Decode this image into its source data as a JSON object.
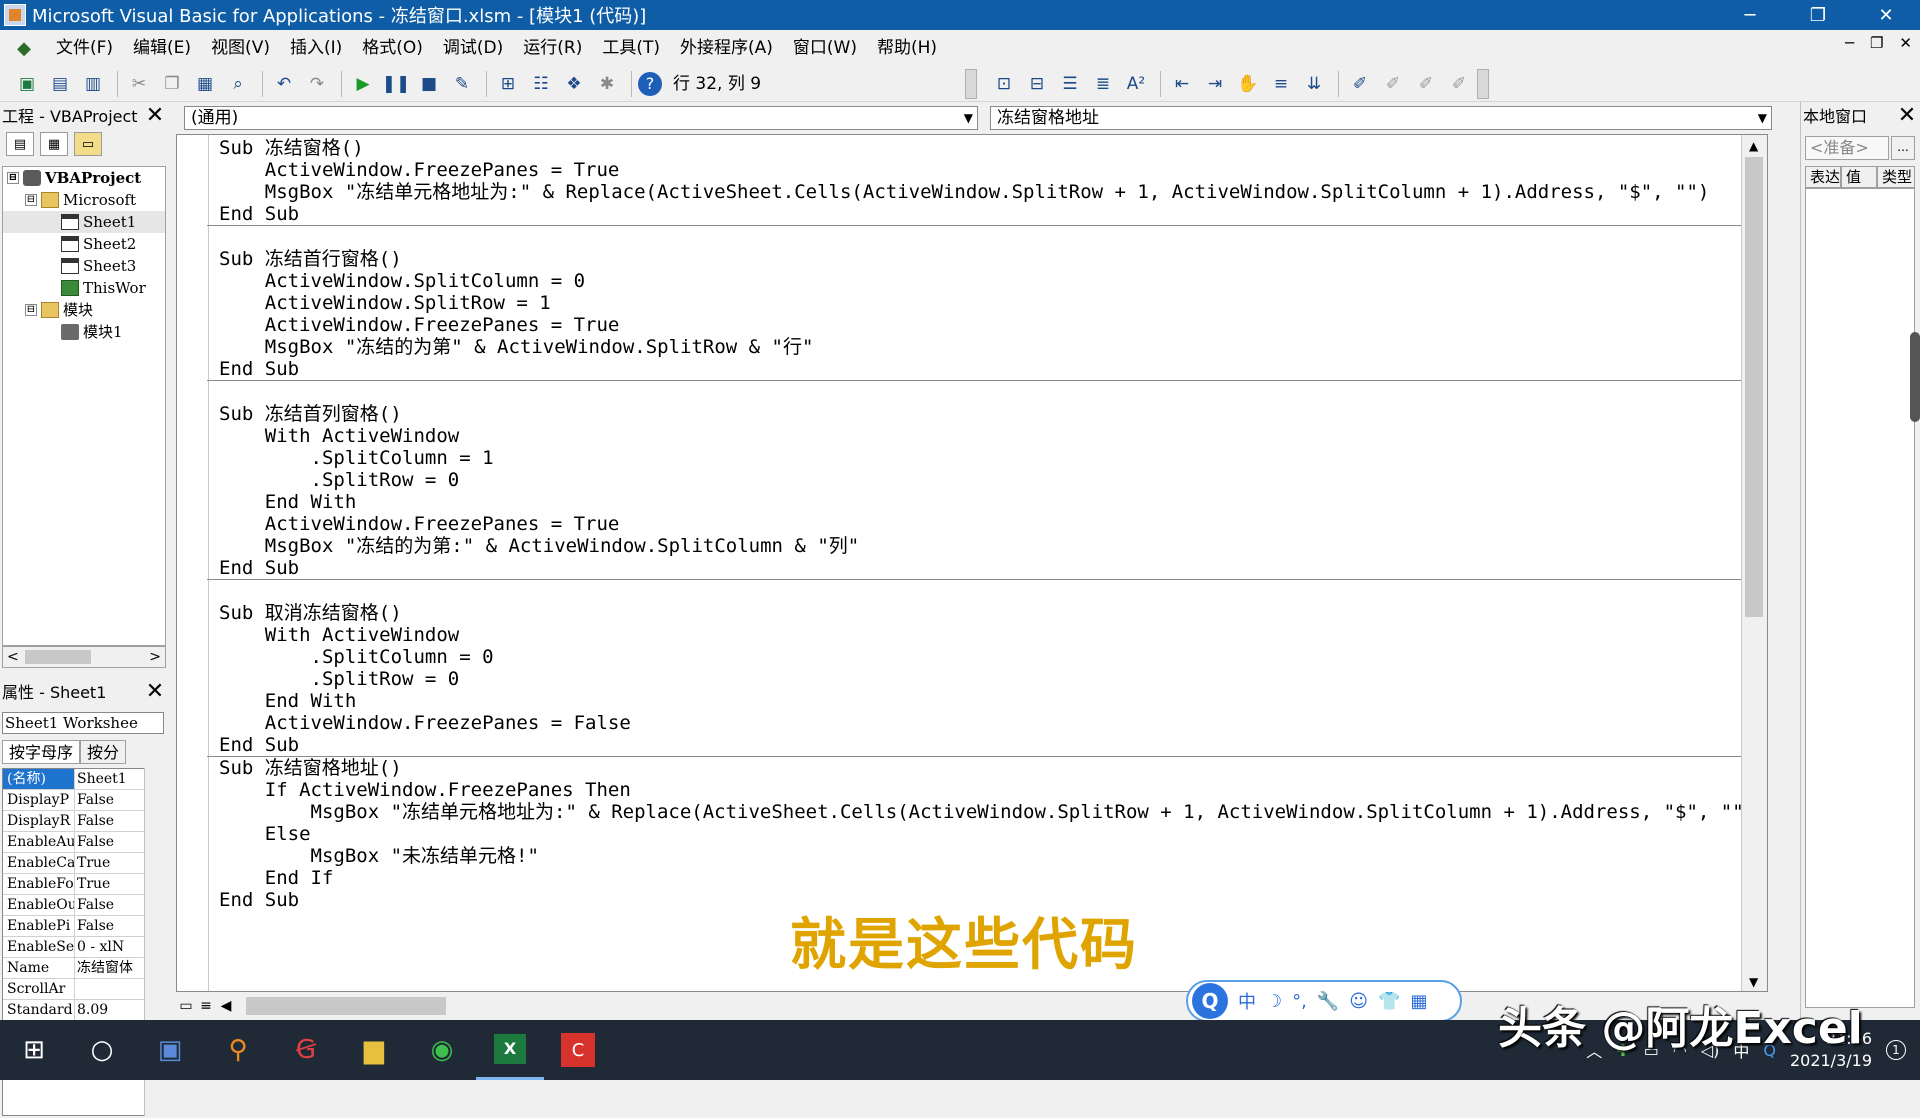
{
  "window": {
    "title": "Microsoft Visual Basic for Applications - 冻结窗口.xlsm - [模块1 (代码)]",
    "min": "─",
    "restore": "❐",
    "close": "✕"
  },
  "menu": [
    "文件(F)",
    "编辑(E)",
    "视图(V)",
    "插入(I)",
    "格式(O)",
    "调试(D)",
    "运行(R)",
    "工具(T)",
    "外接程序(A)",
    "窗口(W)",
    "帮助(H)"
  ],
  "mdi_buttons": {
    "min": "─",
    "restore": "❐",
    "close": "✕"
  },
  "toolbar": {
    "status": "行 32, 列 9",
    "icons": [
      "excel-icon",
      "insert-userform-icon",
      "save-icon",
      "cut-icon",
      "copy-icon",
      "paste-icon",
      "find-icon",
      "undo-icon",
      "redo-icon",
      "run-icon",
      "break-icon",
      "reset-icon",
      "design-mode-icon",
      "project-explorer-icon",
      "properties-icon",
      "object-browser-icon",
      "toolbox-icon",
      "help-icon"
    ]
  },
  "project_panel": {
    "title": "工程 - VBAProject",
    "close": "✕",
    "tree": [
      {
        "label": "VBAProject",
        "level": 0,
        "icon": "project",
        "toggle": "⊟"
      },
      {
        "label": "Microsoft",
        "level": 1,
        "icon": "folder",
        "toggle": "⊟"
      },
      {
        "label": "Sheet1",
        "level": 2,
        "icon": "sheet",
        "toggle": ""
      },
      {
        "label": "Sheet2",
        "level": 2,
        "icon": "sheet",
        "toggle": ""
      },
      {
        "label": "Sheet3",
        "level": 2,
        "icon": "sheet",
        "toggle": ""
      },
      {
        "label": "ThisWor",
        "level": 2,
        "icon": "wb",
        "toggle": ""
      },
      {
        "label": "模块",
        "level": 1,
        "icon": "folder",
        "toggle": "⊟"
      },
      {
        "label": "模块1",
        "level": 2,
        "icon": "mod",
        "toggle": ""
      }
    ],
    "scroll_left": "<",
    "scroll_right": ">"
  },
  "properties_panel": {
    "title": "属性 - Sheet1",
    "close": "✕",
    "object": "Sheet1 Workshee",
    "tabs": [
      "按字母序",
      "按分"
    ],
    "rows": [
      {
        "name": "(名称)",
        "value": "Sheet1"
      },
      {
        "name": "DisplayP",
        "value": "False"
      },
      {
        "name": "DisplayR",
        "value": "False"
      },
      {
        "name": "EnableAu",
        "value": "False"
      },
      {
        "name": "EnableCa",
        "value": "True"
      },
      {
        "name": "EnableFo",
        "value": "True"
      },
      {
        "name": "EnableOu",
        "value": "False"
      },
      {
        "name": "EnablePi",
        "value": "False"
      },
      {
        "name": "EnableSe",
        "value": "0 - xlN"
      },
      {
        "name": "Name",
        "value": "冻结窗体"
      },
      {
        "name": "ScrollAr",
        "value": ""
      },
      {
        "name": "Standard",
        "value": "8.09"
      }
    ]
  },
  "editor": {
    "object_combo": "(通用)",
    "proc_combo": "冻结窗格地址",
    "blocks": [
      [
        "Sub 冻结窗格()",
        "    ActiveWindow.FreezePanes = True",
        "    MsgBox \"冻结单元格地址为:\" & Replace(ActiveSheet.Cells(ActiveWindow.SplitRow + 1, ActiveWindow.SplitColumn + 1).Address, \"$\", \"\")",
        "End Sub"
      ],
      [
        "",
        "Sub 冻结首行窗格()",
        "    ActiveWindow.SplitColumn = 0",
        "    ActiveWindow.SplitRow = 1",
        "    ActiveWindow.FreezePanes = True",
        "    MsgBox \"冻结的为第\" & ActiveWindow.SplitRow & \"行\"",
        "End Sub"
      ],
      [
        "",
        "Sub 冻结首列窗格()",
        "    With ActiveWindow",
        "        .SplitColumn = 1",
        "        .SplitRow = 0",
        "    End With",
        "    ActiveWindow.FreezePanes = True",
        "    MsgBox \"冻结的为第:\" & ActiveWindow.SplitColumn & \"列\"",
        "End Sub"
      ],
      [
        "",
        "Sub 取消冻结窗格()",
        "    With ActiveWindow",
        "        .SplitColumn = 0",
        "        .SplitRow = 0",
        "    End With",
        "    ActiveWindow.FreezePanes = False",
        "End Sub"
      ],
      [
        "Sub 冻结窗格地址()",
        "    If ActiveWindow.FreezePanes Then",
        "        MsgBox \"冻结单元格地址为:\" & Replace(ActiveSheet.Cells(ActiveWindow.SplitRow + 1, ActiveWindow.SplitColumn + 1).Address, \"$\", \"\")",
        "    Else",
        "        MsgBox \"未冻结单元格!\"",
        "    End If",
        "End Sub"
      ]
    ]
  },
  "subtitle": "就是这些代码",
  "ime": {
    "logo": "Q",
    "mode": "中",
    "moon": "☽",
    "punct": "°,",
    "items": [
      "🔧",
      "☺",
      "👕",
      "▦"
    ]
  },
  "locals_panel": {
    "title": "本地窗口",
    "close": "✕",
    "status": "<准备>",
    "more": "...",
    "columns": [
      "表达",
      "值",
      "类型"
    ]
  },
  "taskbar": {
    "date": "2021/3/19",
    "time": "21:56",
    "ime_indicator": "中",
    "notification_count": "1"
  },
  "watermark": "头条 @阿龙Excel"
}
